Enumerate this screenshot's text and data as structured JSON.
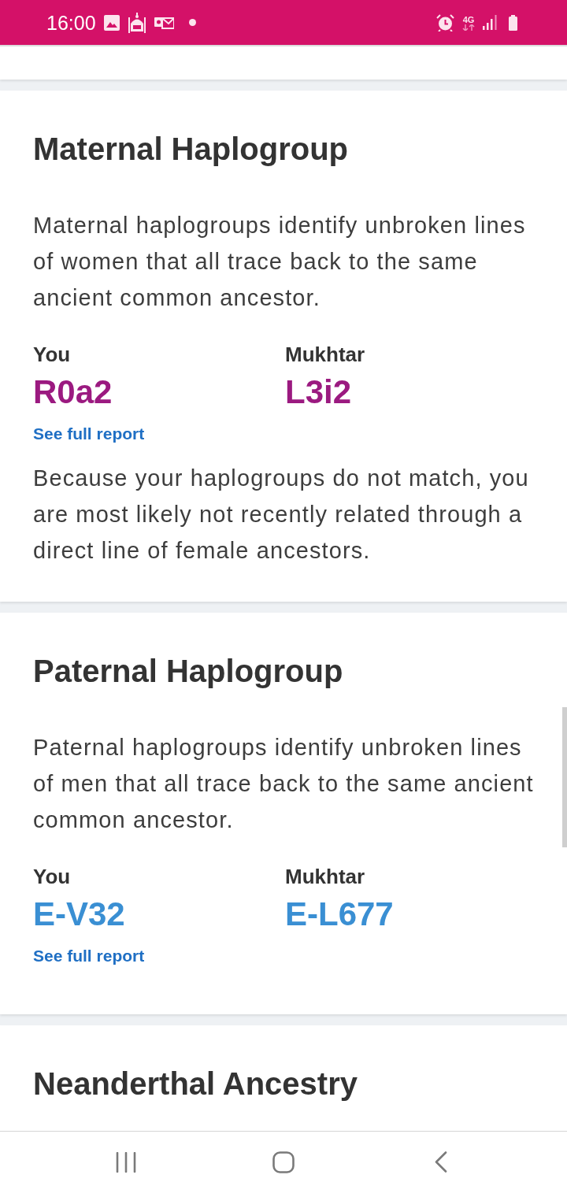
{
  "status_bar": {
    "time": "16:00",
    "network": "4G"
  },
  "sections": [
    {
      "title": "Maternal Haplogroup",
      "description": "Maternal haplogroups identify unbroken lines of women that all trace back to the same ancient common ancestor.",
      "color": "#9b1a80",
      "comparison": [
        {
          "label": "You",
          "value": "R0a2"
        },
        {
          "label": "Mukhtar",
          "value": "L3i2"
        }
      ],
      "link": "See full report",
      "note": "Because your haplogroups do not match, you are most likely not recently related through a direct line of female ancestors."
    },
    {
      "title": "Paternal Haplogroup",
      "description": "Paternal haplogroups identify unbroken lines of men that all trace back to the same ancient common ancestor.",
      "color": "#3a8fd3",
      "comparison": [
        {
          "label": "You",
          "value": "E-V32"
        },
        {
          "label": "Mukhtar",
          "value": "E-L677"
        }
      ],
      "link": "See full report"
    },
    {
      "title": "Neanderthal Ancestry"
    }
  ]
}
